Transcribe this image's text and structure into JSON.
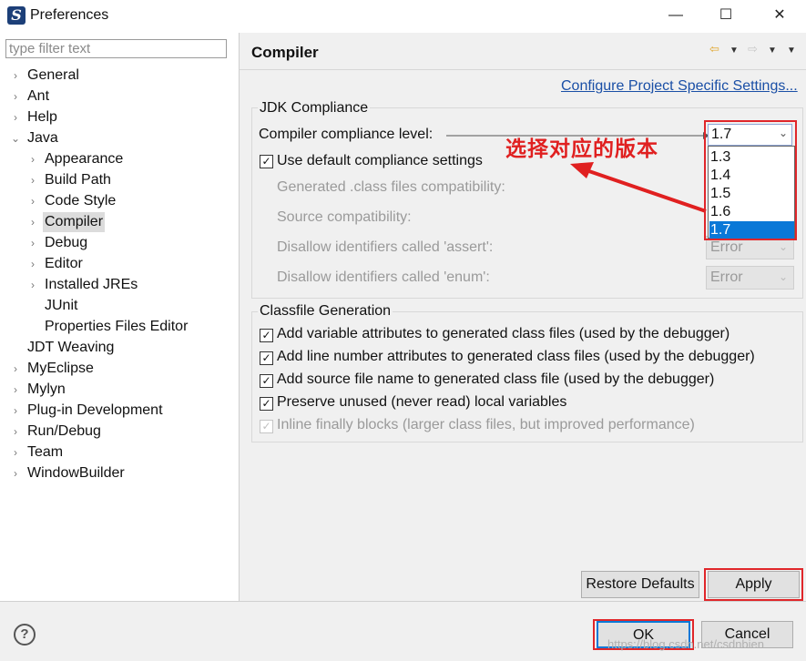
{
  "window": {
    "title": "Preferences",
    "controls": {
      "minimize": "—",
      "maximize": "☐",
      "close": "✕"
    }
  },
  "filter": {
    "placeholder": "type filter text",
    "value": ""
  },
  "tree": {
    "general": "General",
    "ant": "Ant",
    "help": "Help",
    "java": "Java",
    "java_children": [
      "Appearance",
      "Build Path",
      "Code Style",
      "Compiler",
      "Debug",
      "Editor",
      "Installed JREs",
      "JUnit",
      "Properties Files Editor"
    ],
    "jdt_weaving": "JDT Weaving",
    "myeclipse": "MyEclipse",
    "mylyn": "Mylyn",
    "plugin_dev": "Plug-in Development",
    "run_debug": "Run/Debug",
    "team": "Team",
    "windowbuilder": "WindowBuilder"
  },
  "page": {
    "title": "Compiler",
    "configure_link": "Configure Project Specific Settings..."
  },
  "jdk": {
    "group_label": "JDK Compliance",
    "compliance_label": "Compiler compliance level:",
    "compliance_value": "1.7",
    "options": [
      "1.3",
      "1.4",
      "1.5",
      "1.6",
      "1.7"
    ],
    "use_default_label": "Use default compliance settings",
    "generated_label": "Generated .class files compatibility:",
    "source_label": "Source compatibility:",
    "assert_label": "Disallow identifiers called 'assert':",
    "assert_value": "Error",
    "enum_label": "Disallow identifiers called 'enum':",
    "enum_value": "Error"
  },
  "classfile": {
    "group_label": "Classfile Generation",
    "options": [
      "Add variable attributes to generated class files (used by the debugger)",
      "Add line number attributes to generated class files (used by the debugger)",
      "Add source file name to generated class file (used by the debugger)",
      "Preserve unused (never read) local variables",
      "Inline finally blocks (larger class files, but improved performance)"
    ]
  },
  "annotation": "选择对应的版本",
  "buttons": {
    "restore_defaults": "Restore Defaults",
    "apply": "Apply",
    "ok": "OK",
    "cancel": "Cancel"
  },
  "help_icon": "?",
  "watermark": "https://blog.csdn.net/csdnbien",
  "colors": {
    "annotation_red": "#e02020",
    "selection_blue": "#0a78d7",
    "link_blue": "#1a4fa6"
  }
}
